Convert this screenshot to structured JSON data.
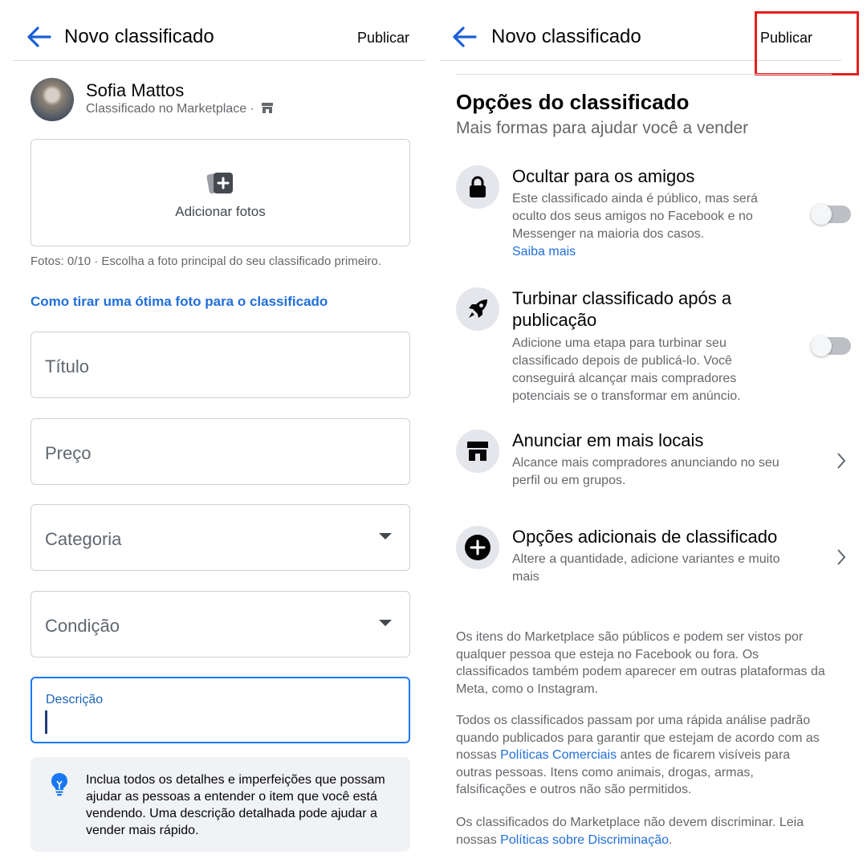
{
  "left": {
    "header": {
      "title": "Novo classificado",
      "publish": "Publicar"
    },
    "profile": {
      "name": "Sofia Mattos",
      "subtitle": "Classificado no Marketplace ·"
    },
    "photos": {
      "add_label": "Adicionar fotos",
      "help": "Fotos: 0/10 · Escolha a foto principal do seu classificado primeiro.",
      "link": "Como tirar uma ótima foto para o classificado"
    },
    "fields": {
      "title": "Título",
      "price": "Preço",
      "category": "Categoria",
      "condition": "Condição",
      "description": "Descrição"
    },
    "tip": "Inclua todos os detalhes e imperfeições que possam ajudar as pessoas a entender o item que você está vendendo. Uma descrição detalhada pode ajudar a vender mais rápido."
  },
  "right": {
    "header": {
      "title": "Novo classificado",
      "publish": "Publicar"
    },
    "section": {
      "title": "Opções do classificado",
      "subtitle": "Mais formas para ajudar você a vender"
    },
    "options": [
      {
        "title": "Ocultar para os amigos",
        "desc": "Este classificado ainda é público, mas será oculto dos seus amigos no Facebook e no Messenger na maioria dos casos.",
        "link": "Saiba mais",
        "toggle_on": false
      },
      {
        "title": "Turbinar classificado após a publicação",
        "desc": "Adicione uma etapa para turbinar seu classificado depois de publicá-lo. Você conseguirá alcançar mais compradores potenciais se o transformar em anúncio.",
        "toggle_on": false
      },
      {
        "title": "Anunciar em mais locais",
        "desc": "Alcance mais compradores anunciando no seu perfil ou em grupos."
      },
      {
        "title": "Opções adicionais de classificado",
        "desc": "Altere a quantidade, adicione variantes e muito mais"
      }
    ],
    "legal": {
      "p1": "Os itens do Marketplace são públicos e podem ser vistos por qualquer pessoa que esteja no Facebook ou fora. Os classificados também podem aparecer em outras plataformas da Meta, como o Instagram.",
      "p2_before": "Todos os classificados passam por uma rápida análise padrão quando publicados para garantir que estejam de acordo com as nossas ",
      "p2_link": "Políticas Comerciais",
      "p2_after": " antes de ficarem visíveis para outras pessoas. Itens como animais, drogas, armas, falsificações e outros não são permitidos.",
      "p3_before": "Os classificados do Marketplace não devem discriminar. Leia nossas ",
      "p3_link": "Políticas sobre Discriminação",
      "p3_after": "."
    }
  },
  "colors": {
    "link": "#216fdb",
    "accent": "#1877f2",
    "highlight": "#e41e1e"
  },
  "icons": [
    "back-arrow-icon",
    "store-icon",
    "add-photo-icon",
    "lightbulb-icon",
    "lock-icon",
    "rocket-icon",
    "shop-icon",
    "plus-circle-icon",
    "chevron-right-icon",
    "caret-down-icon"
  ]
}
